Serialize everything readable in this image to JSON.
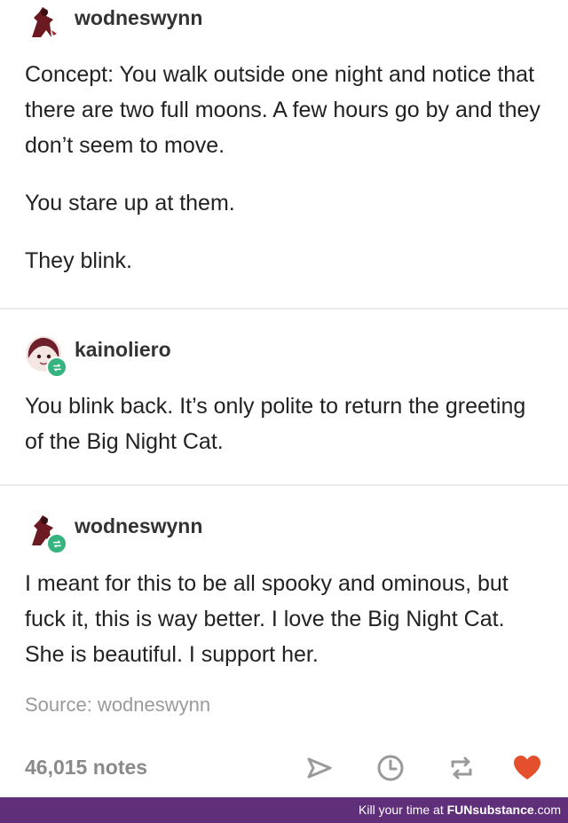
{
  "posts": [
    {
      "username": "wodneswynn",
      "paragraphs": [
        "Concept:  You walk outside one night and notice that there are two full moons. A few hours go by and they don’t seem to move.",
        "You stare up at them.",
        "They blink."
      ]
    },
    {
      "username": "kainoliero",
      "paragraphs": [
        "You blink back. It’s only polite to return the greeting of the Big Night Cat."
      ]
    },
    {
      "username": "wodneswynn",
      "paragraphs": [
        "I meant for this to be all spooky and ominous, but fuck it, this is way better. I love the Big Night Cat. She is beautiful. I support her."
      ]
    }
  ],
  "source": "Source: wodneswynn",
  "footer": {
    "notes": "46,015 notes",
    "icons": [
      "share-icon",
      "clock-icon",
      "reblog-icon",
      "heart-icon"
    ],
    "heart_color": "#e4502b",
    "icon_color": "#9a9a9a"
  },
  "banner": {
    "prefix": "Kill your time at ",
    "brand": "FUNsubstance",
    "suffix": ".com"
  }
}
